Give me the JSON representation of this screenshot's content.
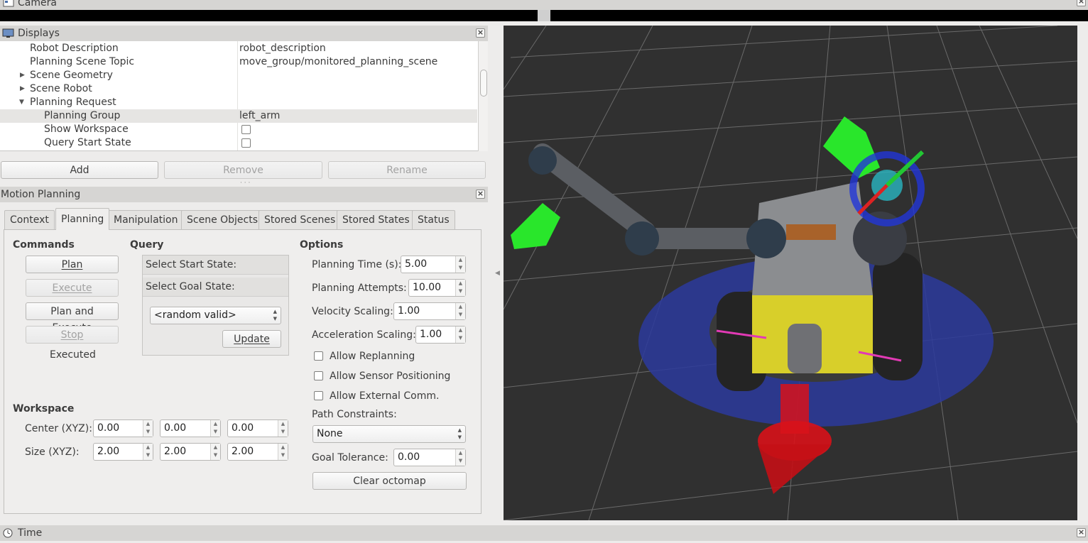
{
  "camera_bar": {
    "title": "Camera"
  },
  "displays": {
    "title": "Displays",
    "rows": [
      {
        "key": "Robot Description",
        "value": "robot_description"
      },
      {
        "key": "Planning Scene Topic",
        "value": "move_group/monitored_planning_scene"
      },
      {
        "key": "Scene Geometry",
        "value": ""
      },
      {
        "key": "Scene Robot",
        "value": ""
      },
      {
        "key": "Planning Request",
        "value": ""
      },
      {
        "key": "Planning Group",
        "value": "left_arm"
      },
      {
        "key": "Show Workspace",
        "value": ""
      },
      {
        "key": "Query Start State",
        "value": ""
      }
    ],
    "add_label": "Add",
    "remove_label": "Remove",
    "rename_label": "Rename"
  },
  "motion_planning": {
    "title": "Motion Planning",
    "tabs": [
      "Context",
      "Planning",
      "Manipulation",
      "Scene Objects",
      "Stored Scenes",
      "Stored States",
      "Status"
    ],
    "active_tab": "Planning",
    "commands": {
      "heading": "Commands",
      "plan": "Plan",
      "execute": "Execute",
      "plan_and_execute": "Plan and Execute",
      "stop": "Stop",
      "status": "Executed"
    },
    "query": {
      "heading": "Query",
      "select_start": "Select Start State:",
      "select_goal": "Select Goal State:",
      "goal_option": "<random valid>",
      "update": "Update"
    },
    "options": {
      "heading": "Options",
      "planning_time_label": "Planning Time (s):",
      "planning_time": "5.00",
      "planning_attempts_label": "Planning Attempts:",
      "planning_attempts": "10.00",
      "velocity_scaling_label": "Velocity Scaling:",
      "velocity_scaling": "1.00",
      "acceleration_scaling_label": "Acceleration Scaling:",
      "acceleration_scaling": "1.00",
      "allow_replanning": "Allow Replanning",
      "allow_sensor_positioning": "Allow Sensor Positioning",
      "allow_external_comm": "Allow External Comm.",
      "path_constraints_label": "Path Constraints:",
      "path_constraints": "None",
      "goal_tolerance_label": "Goal Tolerance:",
      "goal_tolerance": "0.00",
      "clear_octomap": "Clear octomap"
    },
    "workspace": {
      "heading": "Workspace",
      "center_label": "Center (XYZ):",
      "center": [
        "0.00",
        "0.00",
        "0.00"
      ],
      "size_label": "Size (XYZ):",
      "size": [
        "2.00",
        "2.00",
        "2.00"
      ]
    }
  },
  "time_bar": {
    "title": "Time"
  }
}
